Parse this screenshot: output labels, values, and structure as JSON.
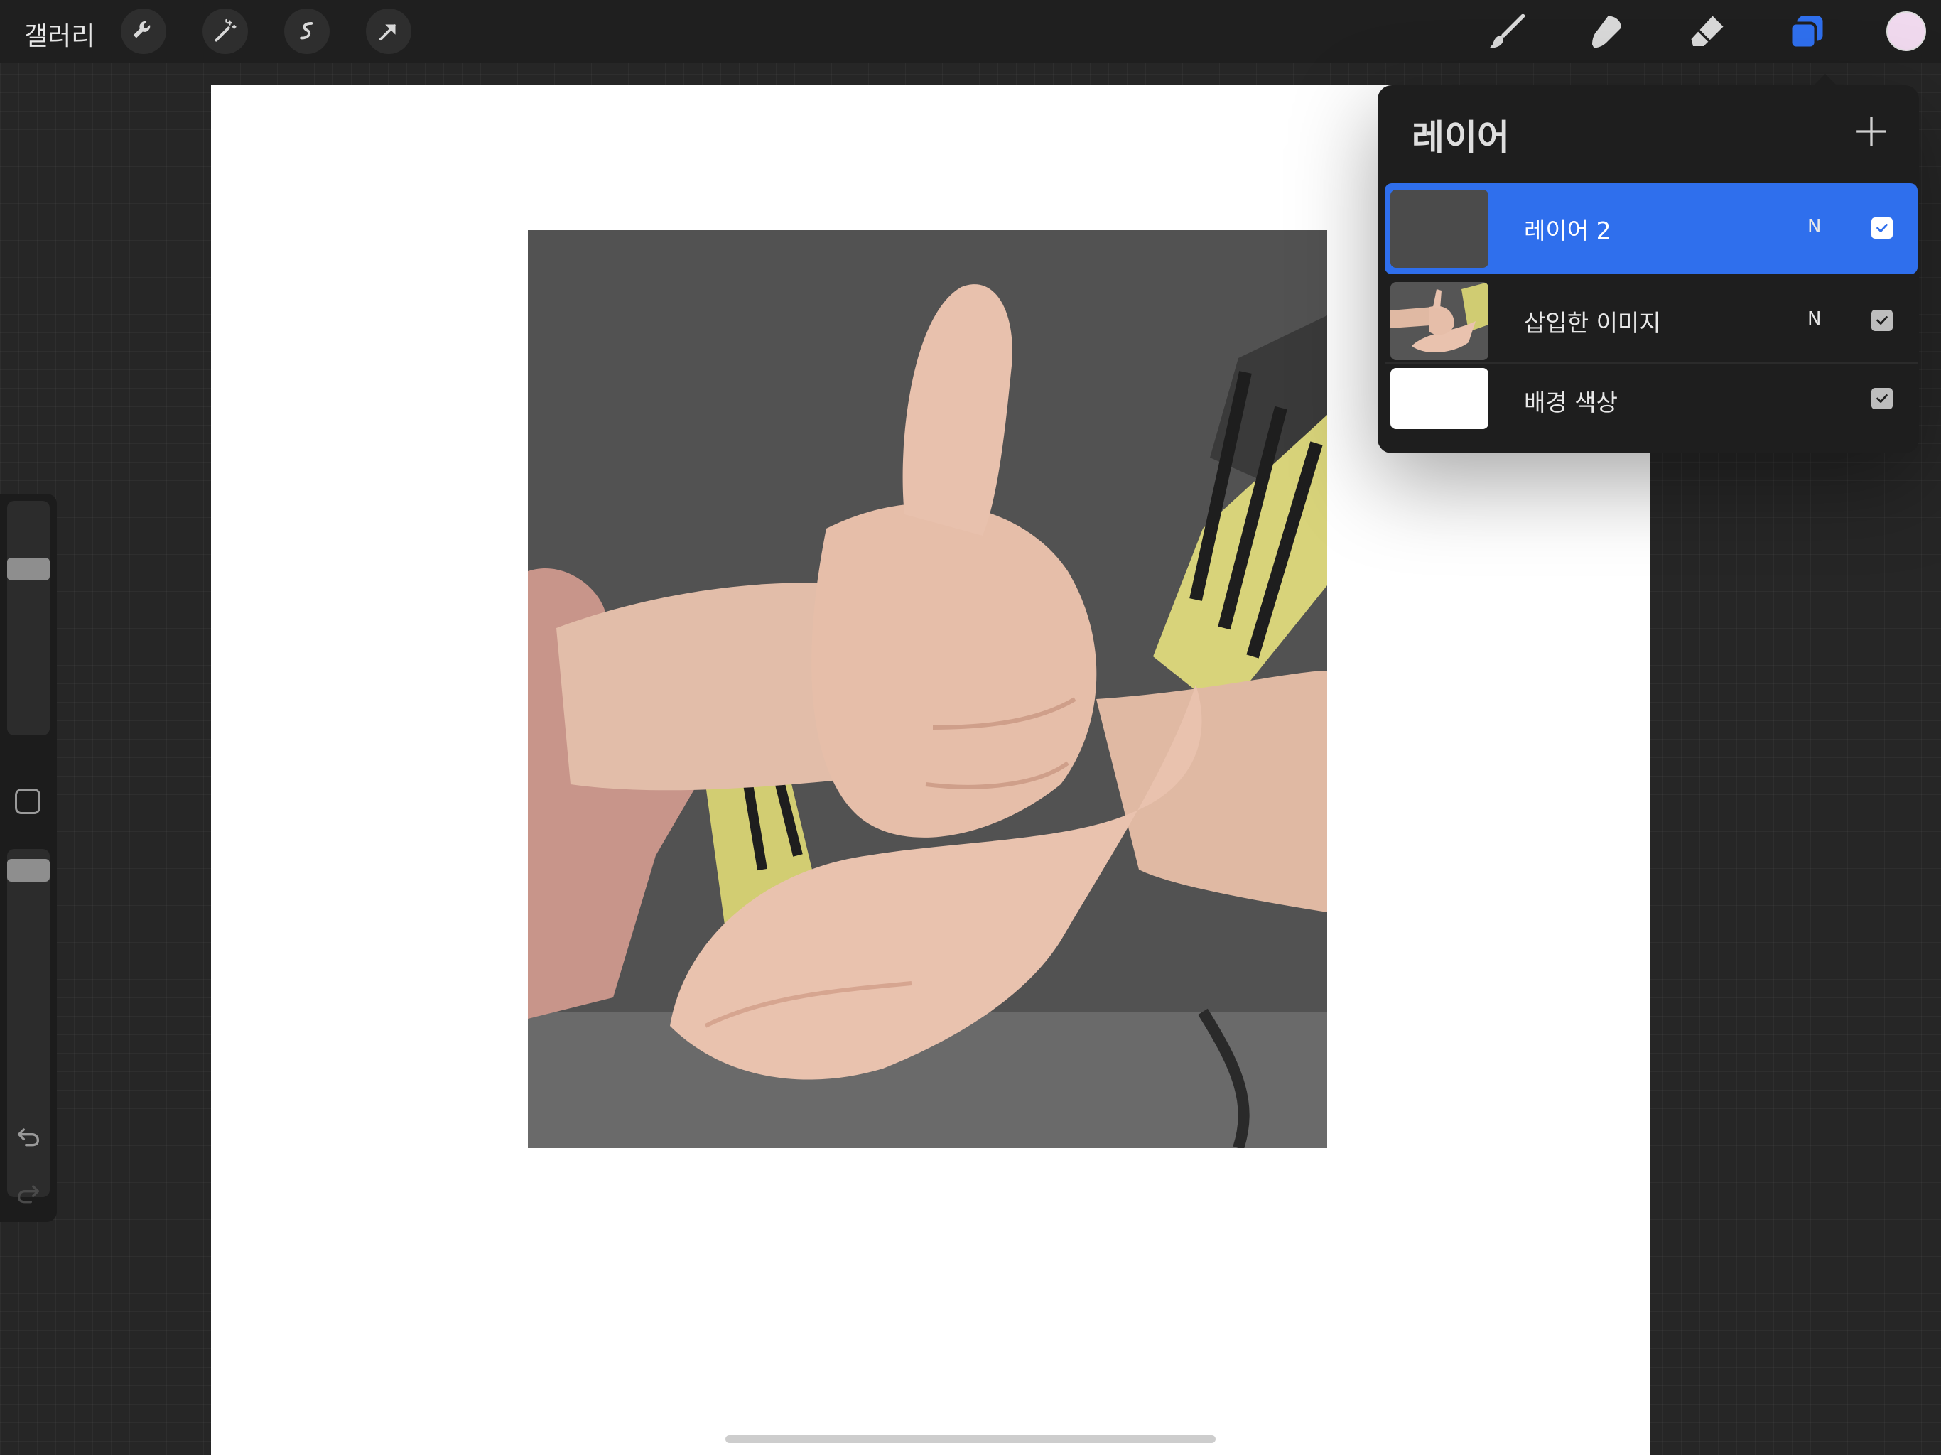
{
  "toolbar": {
    "gallery_label": "갤러리",
    "left_tools": [
      "wrench-icon",
      "magic-wand-icon",
      "selection-icon",
      "transform-arrow-icon"
    ],
    "right_tools": [
      "brush-icon",
      "smudge-icon",
      "eraser-icon",
      "layers-icon"
    ],
    "current_color": "#f0d9ee"
  },
  "layers": {
    "title": "레이어",
    "add_icon": "plus-icon",
    "items": [
      {
        "name": "레이어 2",
        "blend": "N",
        "visible": true,
        "selected": true
      },
      {
        "name": "삽입한 이미지",
        "blend": "N",
        "visible": true,
        "selected": false
      },
      {
        "name": "배경 색상",
        "blend": "",
        "visible": true,
        "selected": false
      }
    ]
  },
  "sidebar": {
    "brush_size_level": 0.27,
    "opacity_level": 0.03,
    "icons": [
      "modify-square-icon",
      "undo-icon",
      "redo-icon"
    ]
  },
  "colors": {
    "accent": "#2f6fed",
    "panel": "#1e1e1e",
    "toolbar": "#1f1f1f"
  }
}
